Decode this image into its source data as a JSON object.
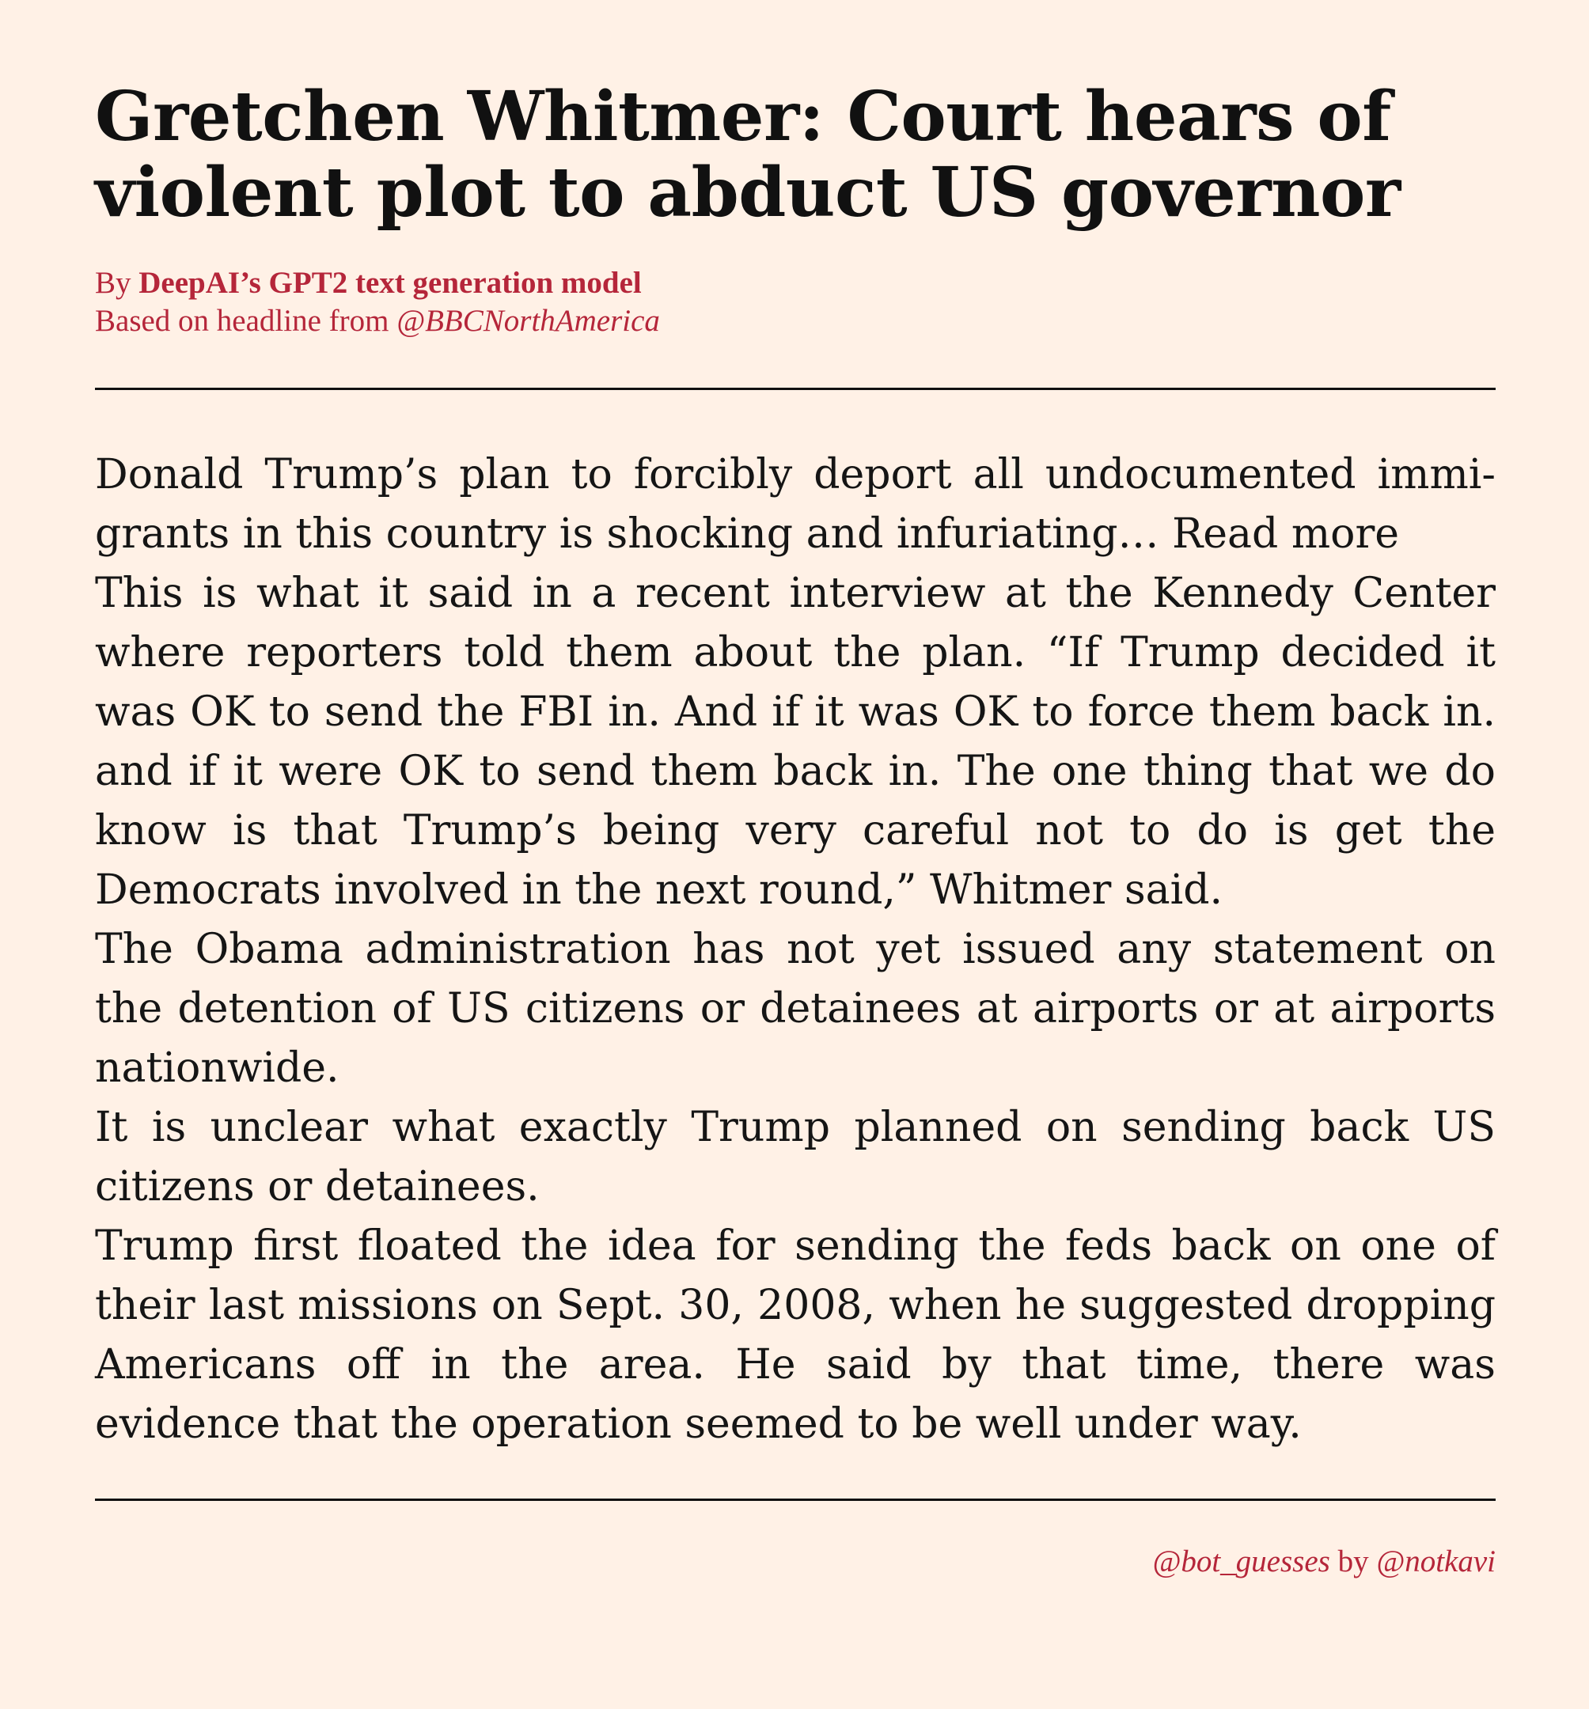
{
  "article": {
    "headline": "Gretchen Whitmer: Court hears of vi­olent plot to abduct US governor",
    "byline_prefix": "By ",
    "author": "DeepAI’s GPT2 text generation model",
    "based_on_prefix": "Based on headline from ",
    "source_handle": "@BBCNorthAmerica",
    "paragraphs": [
      "Donald Trump’s plan to forcibly deport all undocumented immi­grants in this country is shocking and infuriating… Read more",
      "This is what it said in a recent interview at the Kennedy Center where reporters told them about the plan.  “If Trump decided it was OK to send the FBI in.  And if it was OK to force them back in.  and if it were OK to send them back in.  The one thing that we do know is that Trump’s being very careful not to do is get the Democrats involved in the next round,” Whitmer said.",
      "The Obama administration has not yet issued any statement on the detention of US citizens or detainees at airports or at airports nation­wide.",
      "It is unclear what exactly Trump planned on sending back US citizens or detainees.",
      "Trump first floated the idea for sending the feds back on one of their last missions on Sept. 30, 2008, when he suggested dropping Amer­icans off in the area.  He said by that time, there was evidence that the operation seemed to be well under way."
    ]
  },
  "footer": {
    "bot_handle": "@bot_guesses",
    "by_word": " by ",
    "creator_handle": "@notkavi"
  },
  "colors": {
    "background": "#fff1e6",
    "accent": "#b5263a",
    "text": "#111111"
  }
}
